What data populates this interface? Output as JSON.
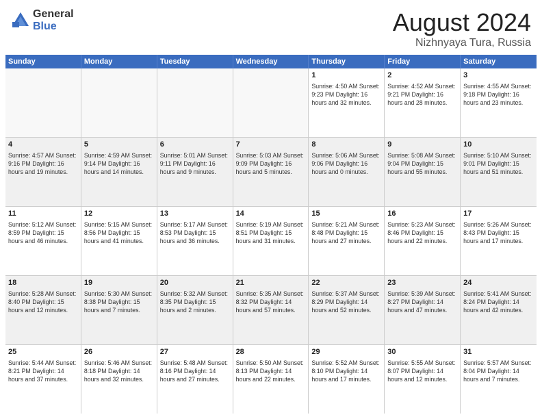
{
  "header": {
    "logo": {
      "general": "General",
      "blue": "Blue"
    },
    "title": "August 2024",
    "location": "Nizhnyaya Tura, Russia"
  },
  "calendar": {
    "weekdays": [
      "Sunday",
      "Monday",
      "Tuesday",
      "Wednesday",
      "Thursday",
      "Friday",
      "Saturday"
    ],
    "rows": [
      [
        {
          "day": "",
          "info": "",
          "empty": true
        },
        {
          "day": "",
          "info": "",
          "empty": true
        },
        {
          "day": "",
          "info": "",
          "empty": true
        },
        {
          "day": "",
          "info": "",
          "empty": true
        },
        {
          "day": "1",
          "info": "Sunrise: 4:50 AM\nSunset: 9:23 PM\nDaylight: 16 hours\nand 32 minutes."
        },
        {
          "day": "2",
          "info": "Sunrise: 4:52 AM\nSunset: 9:21 PM\nDaylight: 16 hours\nand 28 minutes."
        },
        {
          "day": "3",
          "info": "Sunrise: 4:55 AM\nSunset: 9:18 PM\nDaylight: 16 hours\nand 23 minutes."
        }
      ],
      [
        {
          "day": "4",
          "info": "Sunrise: 4:57 AM\nSunset: 9:16 PM\nDaylight: 16 hours\nand 19 minutes."
        },
        {
          "day": "5",
          "info": "Sunrise: 4:59 AM\nSunset: 9:14 PM\nDaylight: 16 hours\nand 14 minutes."
        },
        {
          "day": "6",
          "info": "Sunrise: 5:01 AM\nSunset: 9:11 PM\nDaylight: 16 hours\nand 9 minutes."
        },
        {
          "day": "7",
          "info": "Sunrise: 5:03 AM\nSunset: 9:09 PM\nDaylight: 16 hours\nand 5 minutes."
        },
        {
          "day": "8",
          "info": "Sunrise: 5:06 AM\nSunset: 9:06 PM\nDaylight: 16 hours\nand 0 minutes."
        },
        {
          "day": "9",
          "info": "Sunrise: 5:08 AM\nSunset: 9:04 PM\nDaylight: 15 hours\nand 55 minutes."
        },
        {
          "day": "10",
          "info": "Sunrise: 5:10 AM\nSunset: 9:01 PM\nDaylight: 15 hours\nand 51 minutes."
        }
      ],
      [
        {
          "day": "11",
          "info": "Sunrise: 5:12 AM\nSunset: 8:59 PM\nDaylight: 15 hours\nand 46 minutes."
        },
        {
          "day": "12",
          "info": "Sunrise: 5:15 AM\nSunset: 8:56 PM\nDaylight: 15 hours\nand 41 minutes."
        },
        {
          "day": "13",
          "info": "Sunrise: 5:17 AM\nSunset: 8:53 PM\nDaylight: 15 hours\nand 36 minutes."
        },
        {
          "day": "14",
          "info": "Sunrise: 5:19 AM\nSunset: 8:51 PM\nDaylight: 15 hours\nand 31 minutes."
        },
        {
          "day": "15",
          "info": "Sunrise: 5:21 AM\nSunset: 8:48 PM\nDaylight: 15 hours\nand 27 minutes."
        },
        {
          "day": "16",
          "info": "Sunrise: 5:23 AM\nSunset: 8:46 PM\nDaylight: 15 hours\nand 22 minutes."
        },
        {
          "day": "17",
          "info": "Sunrise: 5:26 AM\nSunset: 8:43 PM\nDaylight: 15 hours\nand 17 minutes."
        }
      ],
      [
        {
          "day": "18",
          "info": "Sunrise: 5:28 AM\nSunset: 8:40 PM\nDaylight: 15 hours\nand 12 minutes."
        },
        {
          "day": "19",
          "info": "Sunrise: 5:30 AM\nSunset: 8:38 PM\nDaylight: 15 hours\nand 7 minutes."
        },
        {
          "day": "20",
          "info": "Sunrise: 5:32 AM\nSunset: 8:35 PM\nDaylight: 15 hours\nand 2 minutes."
        },
        {
          "day": "21",
          "info": "Sunrise: 5:35 AM\nSunset: 8:32 PM\nDaylight: 14 hours\nand 57 minutes."
        },
        {
          "day": "22",
          "info": "Sunrise: 5:37 AM\nSunset: 8:29 PM\nDaylight: 14 hours\nand 52 minutes."
        },
        {
          "day": "23",
          "info": "Sunrise: 5:39 AM\nSunset: 8:27 PM\nDaylight: 14 hours\nand 47 minutes."
        },
        {
          "day": "24",
          "info": "Sunrise: 5:41 AM\nSunset: 8:24 PM\nDaylight: 14 hours\nand 42 minutes."
        }
      ],
      [
        {
          "day": "25",
          "info": "Sunrise: 5:44 AM\nSunset: 8:21 PM\nDaylight: 14 hours\nand 37 minutes."
        },
        {
          "day": "26",
          "info": "Sunrise: 5:46 AM\nSunset: 8:18 PM\nDaylight: 14 hours\nand 32 minutes."
        },
        {
          "day": "27",
          "info": "Sunrise: 5:48 AM\nSunset: 8:16 PM\nDaylight: 14 hours\nand 27 minutes."
        },
        {
          "day": "28",
          "info": "Sunrise: 5:50 AM\nSunset: 8:13 PM\nDaylight: 14 hours\nand 22 minutes."
        },
        {
          "day": "29",
          "info": "Sunrise: 5:52 AM\nSunset: 8:10 PM\nDaylight: 14 hours\nand 17 minutes."
        },
        {
          "day": "30",
          "info": "Sunrise: 5:55 AM\nSunset: 8:07 PM\nDaylight: 14 hours\nand 12 minutes."
        },
        {
          "day": "31",
          "info": "Sunrise: 5:57 AM\nSunset: 8:04 PM\nDaylight: 14 hours\nand 7 minutes."
        }
      ]
    ]
  }
}
